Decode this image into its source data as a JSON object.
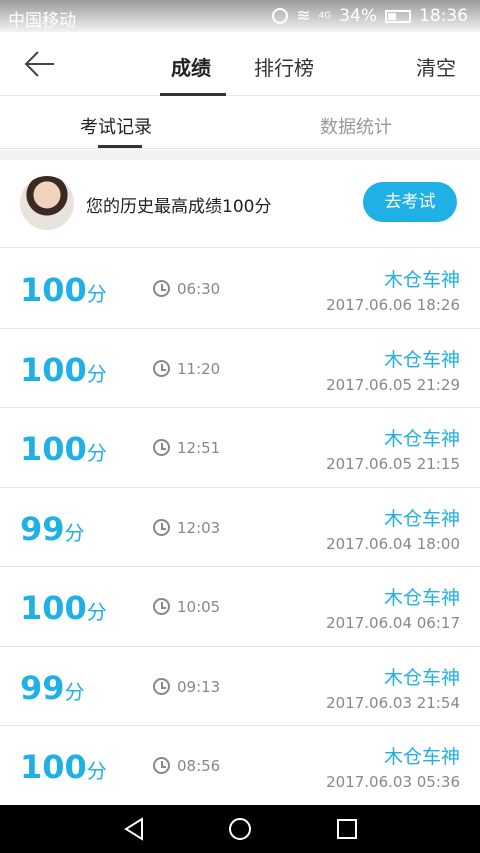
{
  "status_bar": {
    "carrier": "中国移动",
    "network": "4G",
    "battery": "34%",
    "time": "18:36"
  },
  "header": {
    "tabs": [
      {
        "label": "成绩"
      },
      {
        "label": "排行榜"
      }
    ],
    "clear_label": "清空"
  },
  "subtabs": [
    {
      "label": "考试记录"
    },
    {
      "label": "数据统计"
    }
  ],
  "profile": {
    "best_text": "您的历史最高成绩100分",
    "button_label": "去考试"
  },
  "records": [
    {
      "score": "100",
      "unit": "分",
      "duration": "06:30",
      "user": "木仓车神",
      "date": "2017.06.06  18:26"
    },
    {
      "score": "100",
      "unit": "分",
      "duration": "11:20",
      "user": "木仓车神",
      "date": "2017.06.05  21:29"
    },
    {
      "score": "100",
      "unit": "分",
      "duration": "12:51",
      "user": "木仓车神",
      "date": "2017.06.05  21:15"
    },
    {
      "score": "99",
      "unit": "分",
      "duration": "12:03",
      "user": "木仓车神",
      "date": "2017.06.04  18:00"
    },
    {
      "score": "100",
      "unit": "分",
      "duration": "10:05",
      "user": "木仓车神",
      "date": "2017.06.04  06:17"
    },
    {
      "score": "99",
      "unit": "分",
      "duration": "09:13",
      "user": "木仓车神",
      "date": "2017.06.03  21:54"
    },
    {
      "score": "100",
      "unit": "分",
      "duration": "08:56",
      "user": "木仓车神",
      "date": "2017.06.03  05:36"
    }
  ],
  "colors": {
    "accent": "#1fb0e6",
    "text": "#333333",
    "muted": "#888888"
  },
  "icons": {
    "back": "arrow-left-icon",
    "clock": "clock-icon",
    "nav": [
      "back-triangle-icon",
      "home-circle-icon",
      "recents-square-icon"
    ]
  }
}
